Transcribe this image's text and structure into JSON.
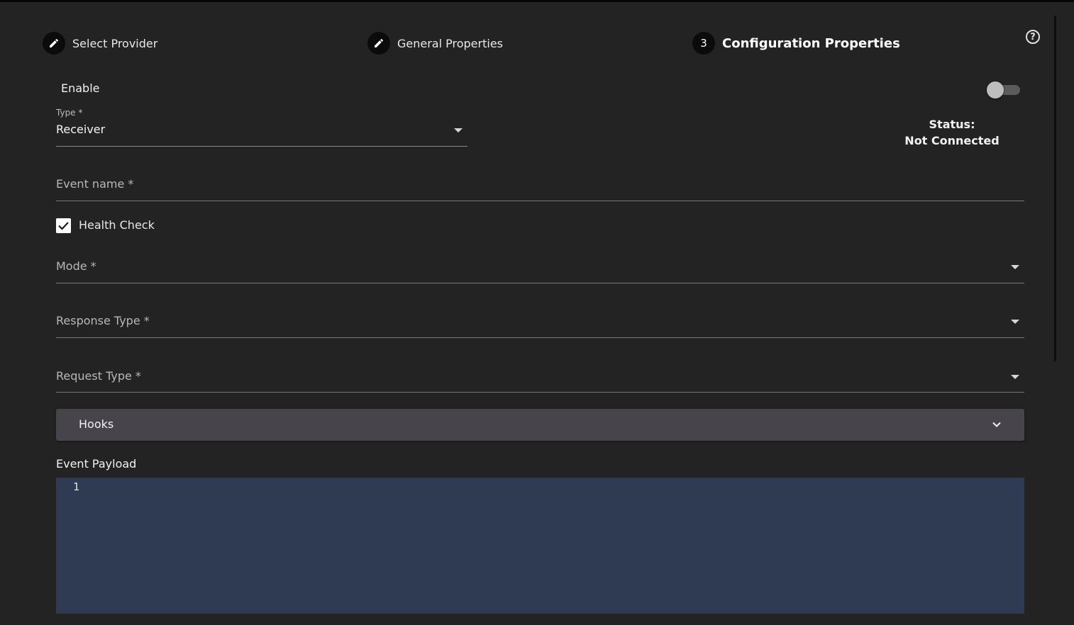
{
  "stepper": {
    "steps": [
      {
        "label": "Select Provider",
        "icon": "pencil-icon"
      },
      {
        "label": "General Properties",
        "icon": "pencil-icon"
      },
      {
        "label": "Configuration Properties",
        "number": "3"
      }
    ],
    "help_icon": "help-circle-icon"
  },
  "enable": {
    "label": "Enable",
    "on": false
  },
  "type_select": {
    "label": "Type *",
    "value": "Receiver"
  },
  "status": {
    "label": "Status:",
    "value": "Not Connected"
  },
  "event_name": {
    "label": "Event name *"
  },
  "health_check": {
    "label": "Health Check",
    "checked": true
  },
  "mode": {
    "label": "Mode *"
  },
  "response_type": {
    "label": "Response Type *"
  },
  "request_type": {
    "label": "Request Type *"
  },
  "hooks": {
    "label": "Hooks"
  },
  "event_payload": {
    "label": "Event Payload",
    "line_number": "1"
  },
  "colors": {
    "background": "#232323",
    "editor": "#2e3b52",
    "accordion": "#48444b"
  }
}
